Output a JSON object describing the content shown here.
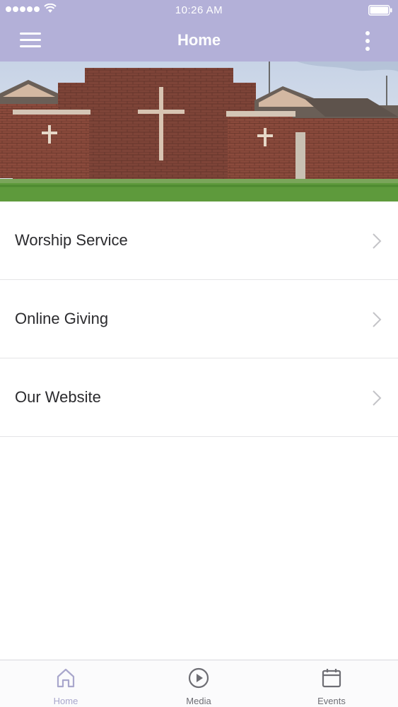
{
  "status_bar": {
    "time": "10:26 AM",
    "signal_bars": 5,
    "icons": [
      "signal-dots-icon",
      "wifi-icon",
      "battery-icon"
    ]
  },
  "header": {
    "title": "Home",
    "left_icon": "hamburger-menu-icon",
    "right_icon": "vertical-ellipsis-icon",
    "background": "#b3b0d8"
  },
  "hero": {
    "image": "church-building-photo"
  },
  "menu": {
    "items": [
      {
        "label": "Worship Service",
        "icon": "chevron-right-icon"
      },
      {
        "label": "Online Giving",
        "icon": "chevron-right-icon"
      },
      {
        "label": "Our Website",
        "icon": "chevron-right-icon"
      }
    ]
  },
  "tab_bar": {
    "tabs": [
      {
        "label": "Home",
        "icon": "home-icon",
        "active": true,
        "color": "#a9a7cc"
      },
      {
        "label": "Media",
        "icon": "play-circle-icon",
        "active": false,
        "color": "#6e6e74"
      },
      {
        "label": "Events",
        "icon": "calendar-icon",
        "active": false,
        "color": "#6e6e74"
      }
    ]
  }
}
